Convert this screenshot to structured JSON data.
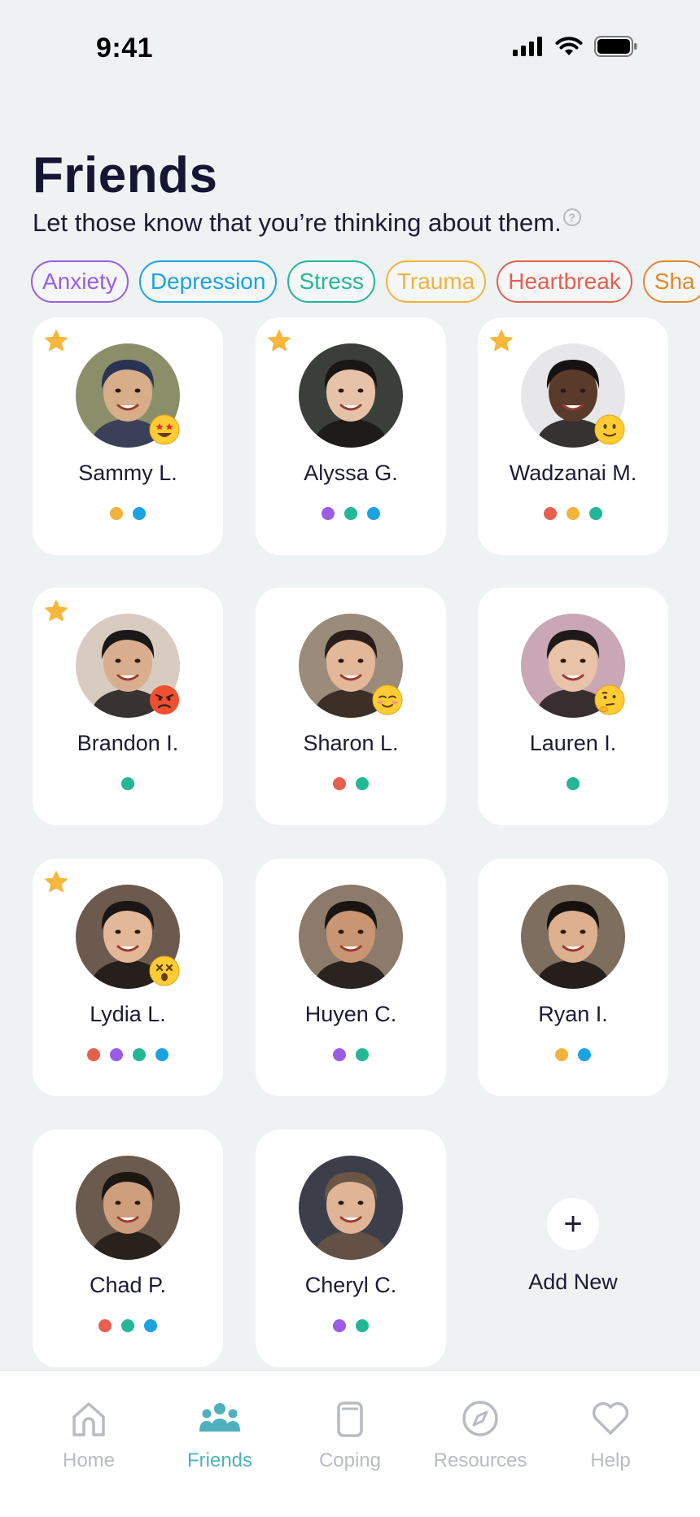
{
  "status_bar": {
    "time": "9:41"
  },
  "header": {
    "title": "Friends",
    "subtitle": "Let those know that you’re thinking about them.",
    "info_icon": "?"
  },
  "filters": [
    {
      "label": "Anxiety",
      "color": "#9b5de5"
    },
    {
      "label": "Depression",
      "color": "#1aa3e0"
    },
    {
      "label": "Stress",
      "color": "#22b795"
    },
    {
      "label": "Trauma",
      "color": "#f2b33d"
    },
    {
      "label": "Heartbreak",
      "color": "#e5604f"
    },
    {
      "label": "Sha",
      "color": "#e08a2c"
    }
  ],
  "colors": {
    "anxiety": "#9b5de5",
    "depression": "#1aa3e0",
    "stress": "#22b795",
    "trauma": "#f2b33d",
    "heartbreak": "#e5604f",
    "star": "#f6b73c",
    "accent": "#4fb1bd"
  },
  "friends": [
    {
      "name": "Sammy L.",
      "starred": true,
      "emoji": "star-struck-face-icon",
      "dots": [
        "#f2b33d",
        "#1aa3e0"
      ]
    },
    {
      "name": "Alyssa G.",
      "starred": true,
      "emoji": "",
      "dots": [
        "#9b5de5",
        "#22b795",
        "#1aa3e0"
      ]
    },
    {
      "name": "Wadzanai M.",
      "starred": true,
      "emoji": "slight-smile-face-icon",
      "dots": [
        "#e5604f",
        "#f2b33d",
        "#22b795"
      ]
    },
    {
      "name": "Brandon I.",
      "starred": true,
      "emoji": "angry-face-icon",
      "dots": [
        "#22b795"
      ]
    },
    {
      "name": "Sharon L.",
      "starred": false,
      "emoji": "blushing-face-icon",
      "dots": [
        "#e5604f",
        "#22b795"
      ]
    },
    {
      "name": "Lauren I.",
      "starred": false,
      "emoji": "thinking-face-icon",
      "dots": [
        "#22b795"
      ]
    },
    {
      "name": "Lydia L.",
      "starred": true,
      "emoji": "dizzy-face-icon",
      "dots": [
        "#e5604f",
        "#9b5de5",
        "#22b795",
        "#1aa3e0"
      ]
    },
    {
      "name": "Huyen C.",
      "starred": false,
      "emoji": "",
      "dots": [
        "#9b5de5",
        "#22b795"
      ]
    },
    {
      "name": "Ryan I.",
      "starred": false,
      "emoji": "",
      "dots": [
        "#f2b33d",
        "#1aa3e0"
      ]
    },
    {
      "name": "Chad P.",
      "starred": false,
      "emoji": "",
      "dots": [
        "#e5604f",
        "#22b795",
        "#1aa3e0"
      ]
    },
    {
      "name": "Cheryl C.",
      "starred": false,
      "emoji": "",
      "dots": [
        "#9b5de5",
        "#22b795"
      ]
    }
  ],
  "add_new": {
    "icon": "+",
    "label": "Add New"
  },
  "tabs": [
    {
      "label": "Home",
      "icon": "home-icon",
      "active": false
    },
    {
      "label": "Friends",
      "icon": "friends-icon",
      "active": true
    },
    {
      "label": "Coping",
      "icon": "coping-icon",
      "active": false
    },
    {
      "label": "Resources",
      "icon": "compass-icon",
      "active": false
    },
    {
      "label": "Help",
      "icon": "heart-icon",
      "active": false
    }
  ]
}
